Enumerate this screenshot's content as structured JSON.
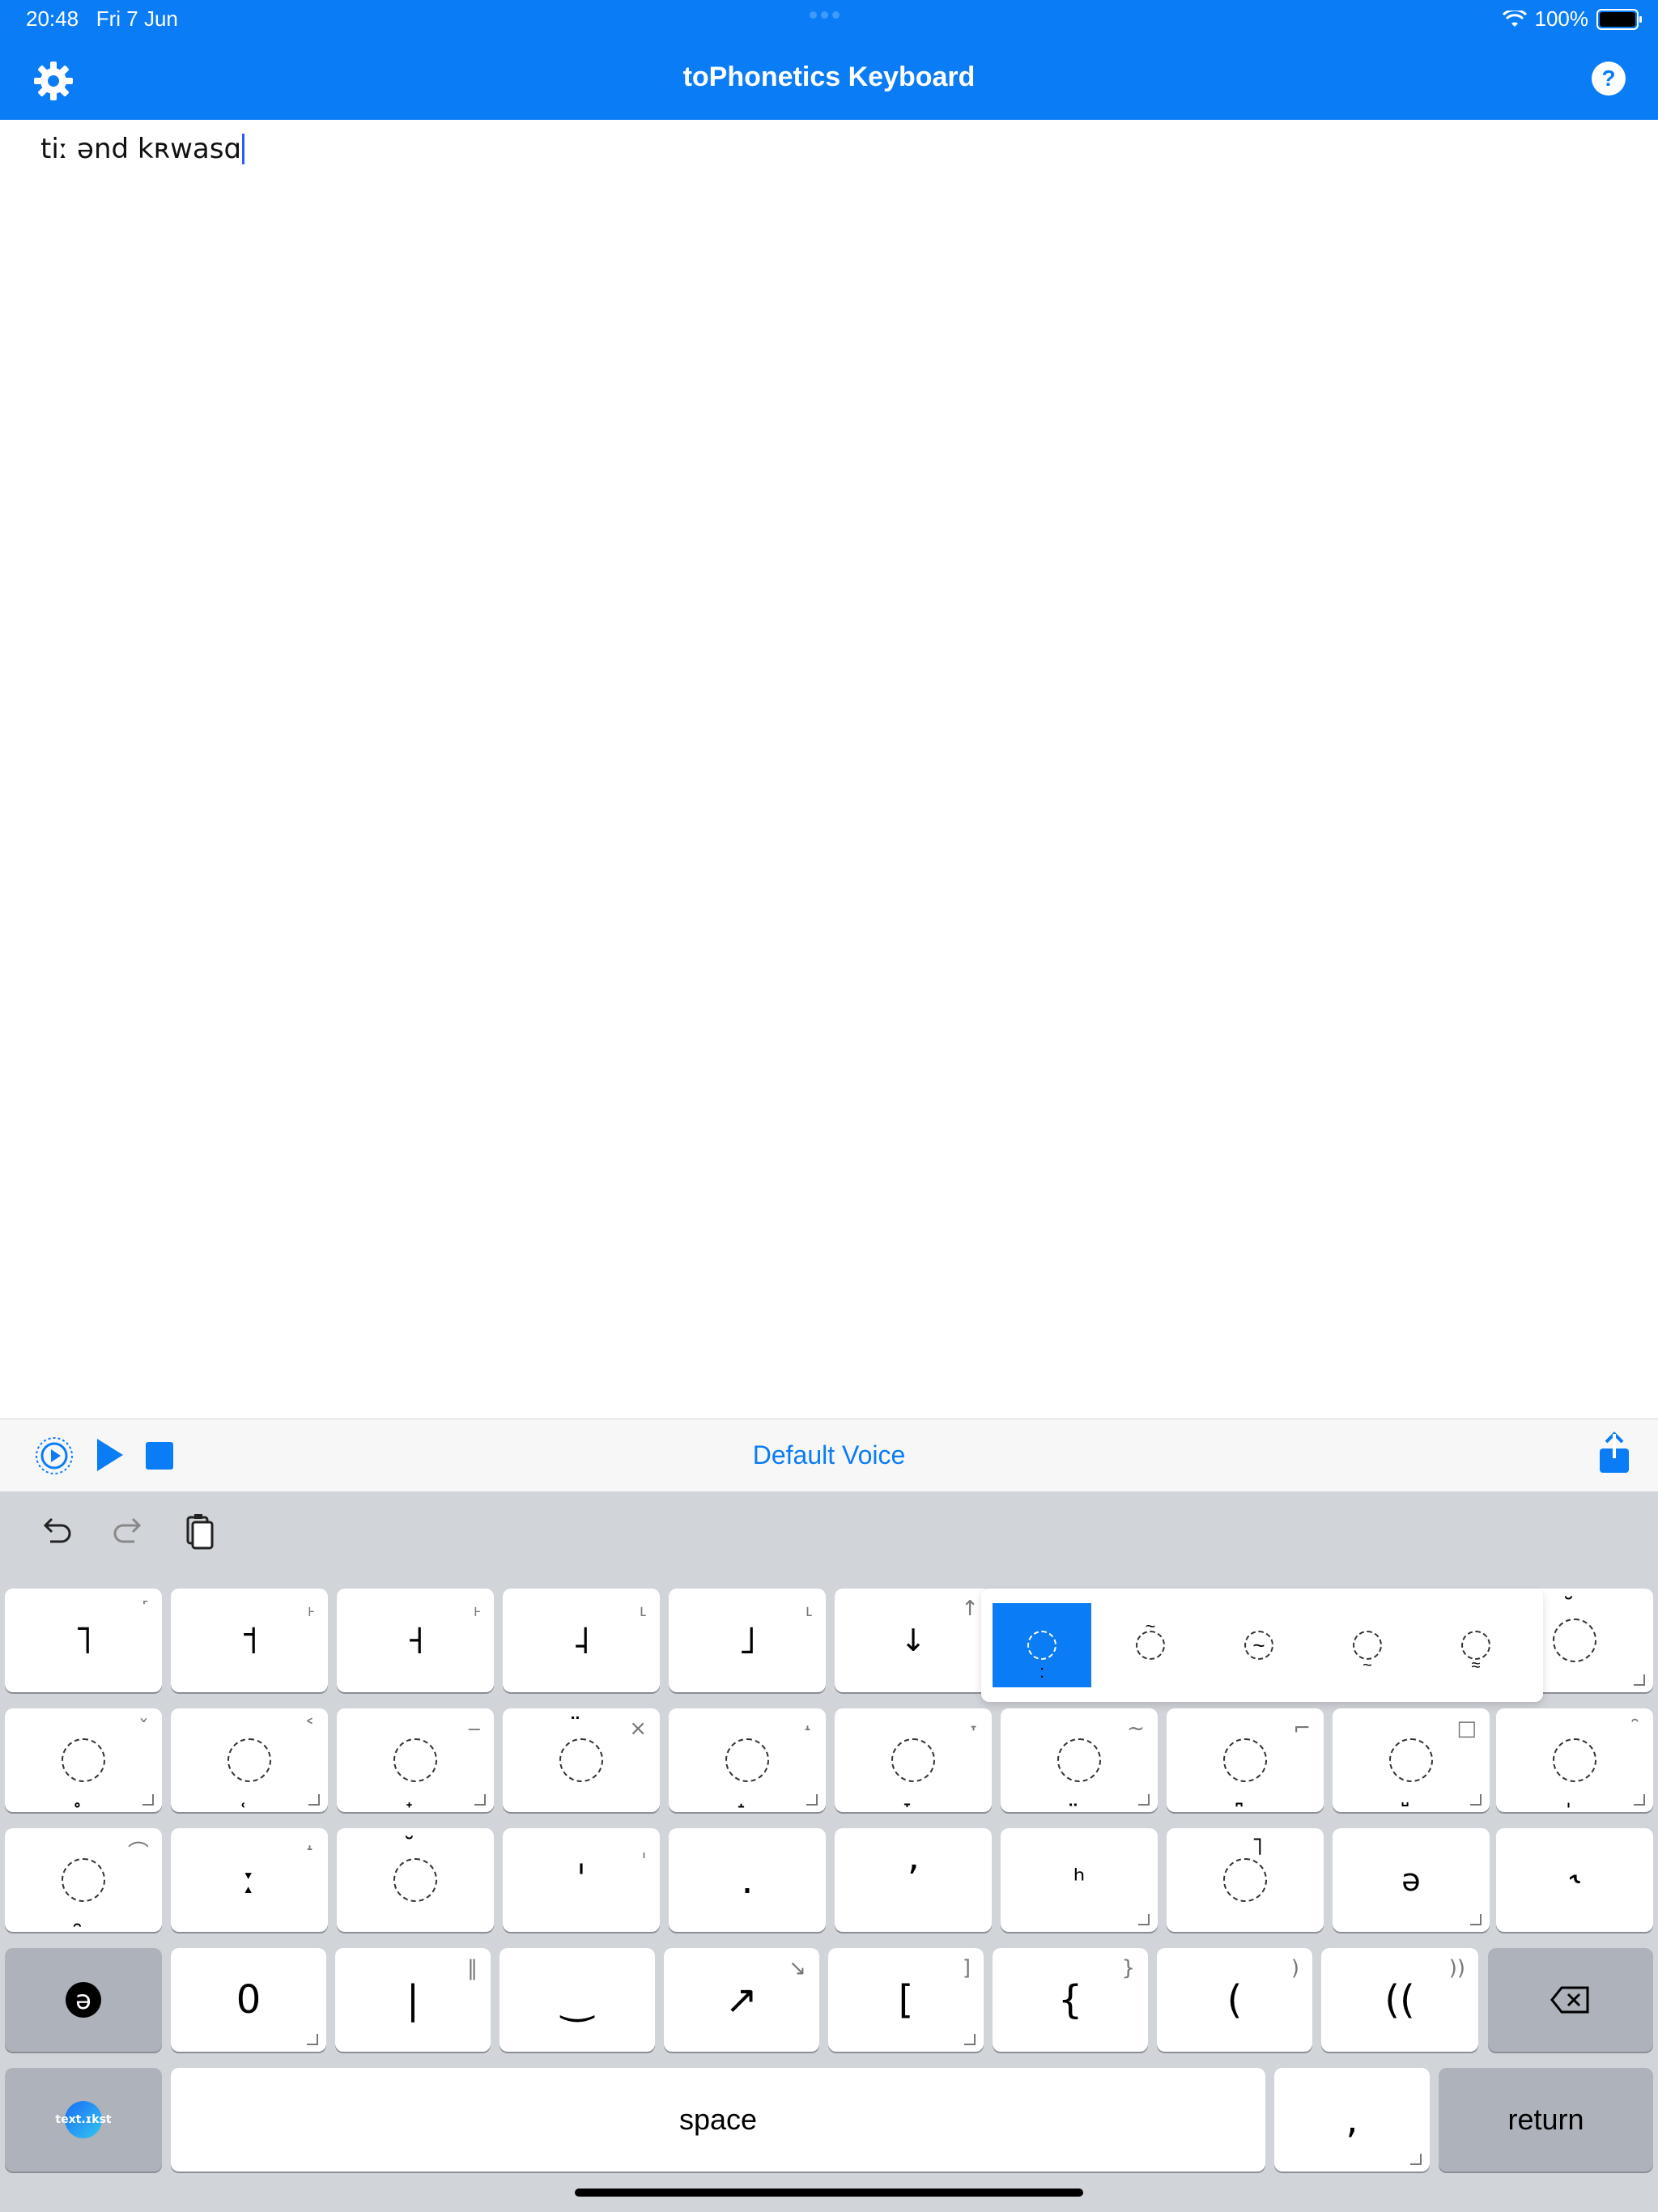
{
  "status": {
    "time": "20:48",
    "date": "Fri 7 Jun",
    "battery": "100%"
  },
  "nav": {
    "title": "toPhonetics Keyboard",
    "help_label": "?"
  },
  "editor": {
    "text": "tiː ənd kʀwasɑ"
  },
  "voice": {
    "label": "Default Voice"
  },
  "keyboard": {
    "row1": [
      {
        "main": "˥",
        "sub": "˹"
      },
      {
        "main": "˦",
        "sub": "˫"
      },
      {
        "main": "˧",
        "sub": "˫"
      },
      {
        "main": "˨",
        "sub": "˪"
      },
      {
        "main": "˩",
        "sub": "˪"
      },
      {
        "main": "↓",
        "sub": "↑"
      }
    ],
    "row1_last": {
      "mark": "̆"
    },
    "popup": {
      "options": [
        ":",
        "~",
        "~",
        "~",
        "≈"
      ],
      "selected_index": 0
    },
    "row2": [
      {
        "mark": "̥",
        "sub": "ˇ"
      },
      {
        "mark": "̜",
        "sub": "˂"
      },
      {
        "mark": "̟",
        "sub": "‒"
      },
      {
        "mark": "̈",
        "sub": "×"
      },
      {
        "mark": "̝",
        "sub": "˔"
      },
      {
        "mark": "̞",
        "sub": "˕"
      },
      {
        "mark": "̤",
        "sub": "~"
      },
      {
        "mark": "̪",
        "sub": "⌐"
      },
      {
        "mark": "̺",
        "sub": "□"
      },
      {
        "mark": "̩",
        "sub": "̑"
      }
    ],
    "row3": [
      {
        "mark": "̯",
        "sub": "⌒"
      },
      {
        "main": "ː",
        "sub": "˔"
      },
      {
        "mark": "̆",
        "sub": ""
      },
      {
        "main": "ˈ",
        "sub": "ˌ"
      },
      {
        "main": ".",
        "sub": ""
      },
      {
        "main": "ʼ",
        "sub": ""
      },
      {
        "main": "ʰ",
        "sub": ""
      },
      {
        "mark": "˥",
        "sub": ""
      },
      {
        "main": "ə",
        "sub": ""
      },
      {
        "main": "˞",
        "sub": ""
      }
    ],
    "row4": [
      {
        "main": "0",
        "sub": ""
      },
      {
        "main": "|",
        "sub": "‖"
      },
      {
        "main": "‿",
        "sub": ""
      },
      {
        "main": "↗",
        "sub": "↘"
      },
      {
        "main": "[",
        "sub": "]"
      },
      {
        "main": "{",
        "sub": "}"
      },
      {
        "main": "(",
        "sub": ")"
      },
      {
        "main": "((",
        "sub": "))"
      }
    ],
    "space_label": "space",
    "comma_label": ",",
    "return_label": "return",
    "keyboard_switch_badge": "ə",
    "logo_text": "text.ɪkst"
  },
  "colors": {
    "accent": "#0a7cf5",
    "keyboard_bg": "#d1d4d9",
    "key_dark": "#adb2bb"
  }
}
